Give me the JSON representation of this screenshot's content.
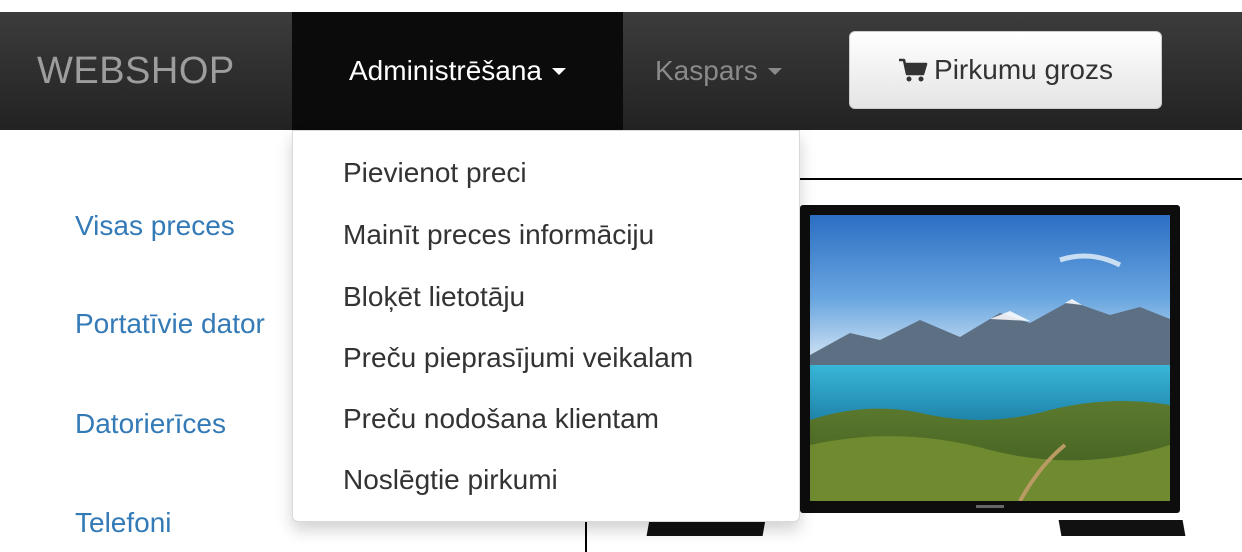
{
  "navbar": {
    "brand": "WEBSHOP",
    "admin_menu": "Administrēšana",
    "user_menu": "Kaspars",
    "cart_button": "Pirkumu grozs",
    "cart_icon": "shopping-cart-icon"
  },
  "admin_dropdown": {
    "items": [
      "Pievienot preci",
      "Mainīt preces informāciju",
      "Bloķēt lietotāju",
      "Preču pieprasījumi veikalam",
      "Preču nodošana klientam",
      "Noslēgtie pirkumi"
    ]
  },
  "sidebar": {
    "items": [
      "Visas preces",
      "Portatīvie dator",
      "Datorierīces",
      "Telefoni"
    ]
  },
  "colors": {
    "navbar_bg": "#222222",
    "active_nav_bg": "#0b0b0b",
    "link": "#337ab7"
  }
}
